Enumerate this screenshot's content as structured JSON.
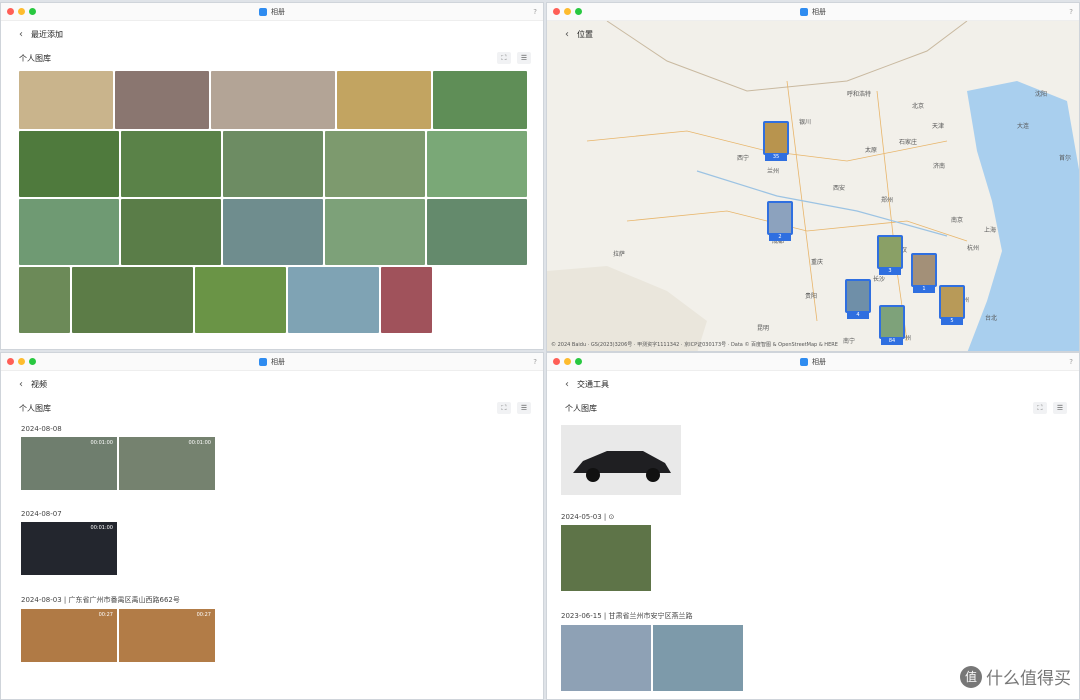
{
  "app_title": "相册",
  "help": "?",
  "library": "个人图库",
  "win1": {
    "header": "最近添加"
  },
  "win2": {
    "header": "位置",
    "copyright": "© 2024 Baidu · GS(2023)3206号 · 甲测资字1111342 · 京ICP证030173号 · Data © 百度智图 & OpenStreetMap & HERE",
    "cities": [
      "北京",
      "天津",
      "石家庄",
      "西宁",
      "兰州",
      "西安",
      "银川",
      "呼和浩特",
      "成都",
      "重庆",
      "贵阳",
      "昆明",
      "拉萨",
      "长沙",
      "武汉",
      "南京",
      "上海",
      "杭州",
      "福州",
      "广州",
      "南宁",
      "郑州",
      "济南",
      "太原",
      "沈阳",
      "大连",
      "台北",
      "首尔"
    ],
    "pins": [
      {
        "count": "35"
      },
      {
        "count": "2"
      },
      {
        "count": "3"
      },
      {
        "count": "1"
      },
      {
        "count": "4"
      },
      {
        "count": "84"
      },
      {
        "count": "5"
      }
    ]
  },
  "win3": {
    "header": "视频",
    "groups": [
      {
        "date": "2024-08-08",
        "durations": [
          "00:01:00",
          "00:01:00"
        ]
      },
      {
        "date": "2024-08-07",
        "durations": [
          "00:01:00"
        ]
      },
      {
        "date": "2024-08-03 | 广东省广州市番禺区禹山西路662号",
        "durations": [
          "00:27",
          "00:27"
        ]
      }
    ]
  },
  "win4": {
    "header": "交通工具",
    "groups": [
      {
        "date": "2024-05-03 | ⊙"
      },
      {
        "date": "2023-06-15 | 甘肃省兰州市安宁区燕兰路"
      }
    ]
  },
  "watermark": {
    "badge": "值",
    "text": "什么值得买"
  }
}
